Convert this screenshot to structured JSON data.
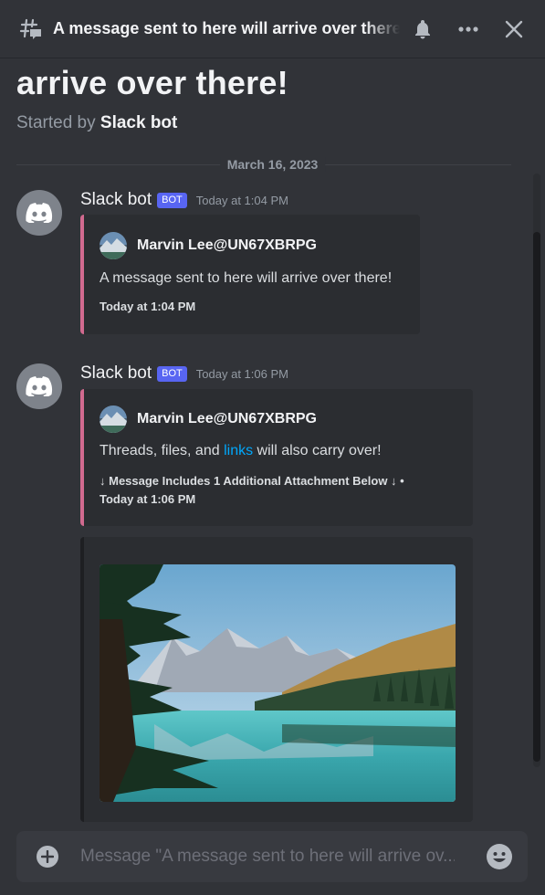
{
  "header": {
    "title": "A message sent to here will arrive over there!",
    "icons": [
      "thread-icon",
      "bell-icon",
      "more-icon",
      "close-icon"
    ]
  },
  "thread": {
    "title_visible": "arrive over there!",
    "started_by_prefix": "Started by",
    "started_by_name": "Slack bot"
  },
  "divider": {
    "date": "March 16, 2023"
  },
  "messages": [
    {
      "author": "Slack bot",
      "tag": "BOT",
      "timestamp": "Today at 1:04 PM",
      "embed": {
        "author": "Marvin Lee@UN67XBRPG",
        "description": "A message sent to here will arrive over there!",
        "footer": "Today at 1:04 PM"
      }
    },
    {
      "author": "Slack bot",
      "tag": "BOT",
      "timestamp": "Today at 1:06 PM",
      "embed": {
        "author": "Marvin Lee@UN67XBRPG",
        "description_pre": "Threads, files, and ",
        "description_link": "links",
        "description_post": " will also carry over!",
        "footer_line1": "↓ Message Includes 1 Additional Attachment Below ↓ •",
        "footer_line2": "Today at 1:06 PM"
      }
    }
  ],
  "composer": {
    "placeholder": "Message \"A message sent to here will arrive ov..."
  },
  "colors": {
    "background": "#313338",
    "embed_accent": "#d16a8f",
    "bot_tag": "#5865f2",
    "link": "#00a8fc"
  }
}
